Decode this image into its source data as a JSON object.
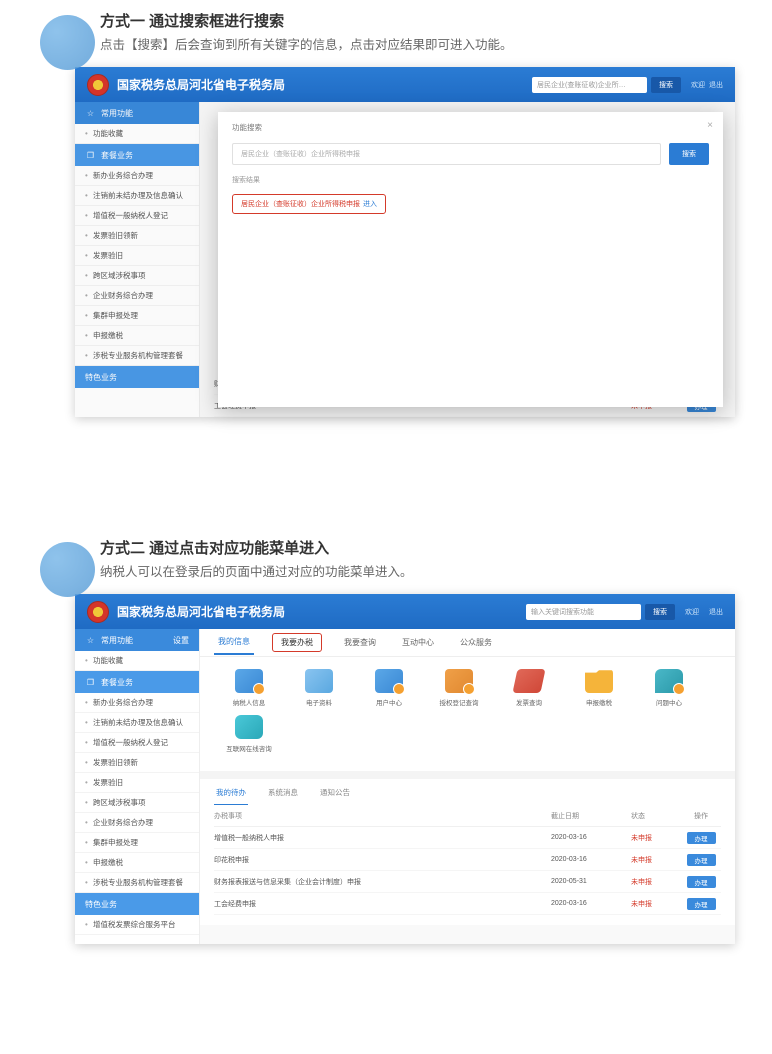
{
  "section1": {
    "title": "方式一 通过搜索框进行搜索",
    "sub": "点击【搜索】后会查询到所有关键字的信息，点击对应结果即可进入功能。"
  },
  "section2": {
    "title": "方式二 通过点击对应功能菜单进入",
    "sub": "纳税人可以在登录后的页面中通过对应的功能菜单进入。"
  },
  "app": {
    "title": "国家税务总局河北省电子税务局",
    "top_search_placeholder1": "居民企业(查账征收)企业所…",
    "top_search_placeholder2": "输入关键词搜索功能",
    "search_btn": "搜索",
    "user": "欢迎",
    "exit": "退出"
  },
  "sidebar": {
    "group1": "常用功能",
    "group1_badge": "设置",
    "item1": "功能收藏",
    "group2": "套餐业务",
    "items": [
      "新办业务综合办理",
      "注销前未结办理及信息确认",
      "增值税一般纳税人登记",
      "发票验旧领新",
      "发票验旧",
      "跨区域涉税事项",
      "企业财务综合办理",
      "集群申报处理",
      "申报缴税",
      "涉税专业服务机构管理套餐"
    ],
    "group3": "特色业务",
    "item_extra": "增值税发票综合服务平台"
  },
  "tabs": {
    "t1": "我的信息",
    "t2": "我要办税",
    "t3": "我要查询",
    "t4": "互动中心",
    "t5": "公众服务"
  },
  "modal": {
    "title": "功能搜索",
    "placeholder": "居民企业（查账征收）企业所得税申报",
    "btn": "搜索",
    "hr": "搜索结果",
    "result_text": "居民企业（查账征收）企业所得税申报",
    "result_link": "进入"
  },
  "peek": {
    "label": "申报缴税"
  },
  "icons": {
    "i1": "纳税人信息",
    "i2": "电子资料",
    "i3": "用户中心",
    "i4": "授权登记查询",
    "i5": "发票查询",
    "i6": "申报缴税",
    "i7": "问题中心",
    "i8": "互联网在线咨询"
  },
  "subtabs": {
    "s1": "我的待办",
    "s2": "系统消息",
    "s3": "通知公告"
  },
  "table": {
    "h1": "办税事项",
    "h2": "截止日期",
    "h3": "状态",
    "h4": "操作",
    "rows": [
      {
        "c1": "增值税一般纳税人申报",
        "c2": "2020-03-16",
        "c3": "未申报",
        "c4": "办理"
      },
      {
        "c1": "印花税申报",
        "c2": "2020-03-16",
        "c3": "未申报",
        "c4": "办理"
      },
      {
        "c1": "财务报表报送与信息采集（企业会计制度）申报",
        "c2": "2020-05-31",
        "c3": "未申报",
        "c4": "办理"
      },
      {
        "c1": "工会经费申报",
        "c2": "2020-03-16",
        "c3": "未申报",
        "c4": "办理"
      }
    ]
  }
}
